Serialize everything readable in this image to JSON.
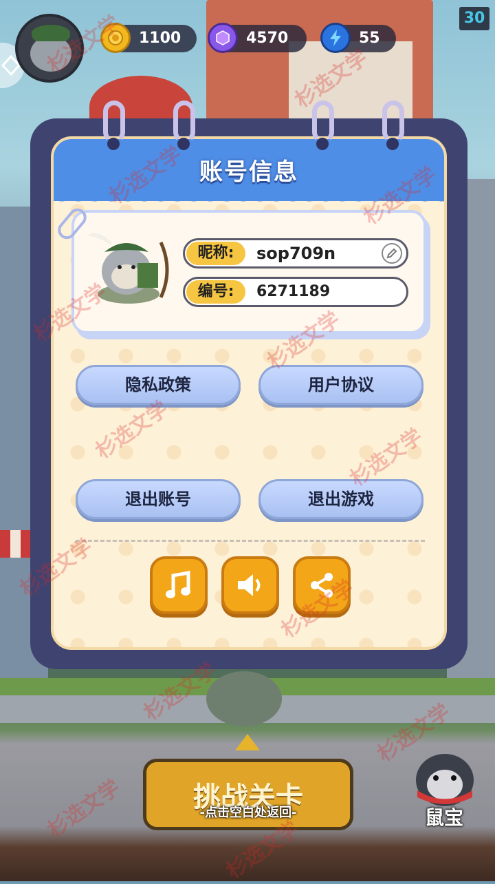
{
  "hud": {
    "fps": "30",
    "coins": "1100",
    "gems": "4570",
    "energy": "55"
  },
  "dialog": {
    "title": "账号信息",
    "nickname_label": "昵称:",
    "nickname_value": "sop709n",
    "id_label": "编号:",
    "id_value": "6271189",
    "privacy_button": "隐私政策",
    "agreement_button": "用户协议",
    "logout_button": "退出账号",
    "exit_game_button": "退出游戏",
    "icon_buttons": [
      "music-icon",
      "sound-icon",
      "share-icon"
    ]
  },
  "bottom": {
    "challenge_label": "挑战关卡",
    "hint": "-点击空白处返回-",
    "mascot_label": "鼠宝"
  },
  "watermark": "杉选文学",
  "colors": {
    "header_blue": "#4f8ee6",
    "modal_frame": "#3f4370",
    "button_blue": "#b8ceff",
    "icon_button_orange": "#f2a618",
    "label_yellow": "#f6c542"
  }
}
